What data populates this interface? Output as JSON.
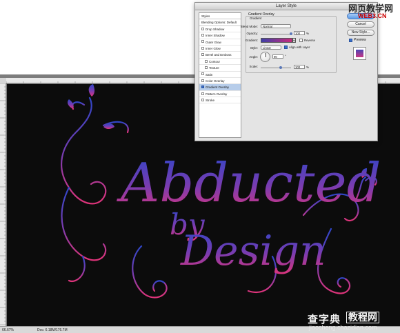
{
  "dialog": {
    "title": "Layer Style",
    "styles_list": [
      {
        "label": "Styles",
        "checkbox": false,
        "checked": false,
        "header": true
      },
      {
        "label": "Blending Options: Default",
        "checkbox": false,
        "checked": false,
        "header": true
      },
      {
        "label": "Drop Shadow",
        "checkbox": true,
        "checked": false
      },
      {
        "label": "Inner Shadow",
        "checkbox": true,
        "checked": false
      },
      {
        "label": "Outer Glow",
        "checkbox": true,
        "checked": false
      },
      {
        "label": "Inner Glow",
        "checkbox": true,
        "checked": false
      },
      {
        "label": "Bevel and Emboss",
        "checkbox": true,
        "checked": false
      },
      {
        "label": "Contour",
        "checkbox": true,
        "checked": false,
        "sub": true
      },
      {
        "label": "Texture",
        "checkbox": true,
        "checked": false,
        "sub": true
      },
      {
        "label": "Satin",
        "checkbox": true,
        "checked": false
      },
      {
        "label": "Color Overlay",
        "checkbox": true,
        "checked": false
      },
      {
        "label": "Gradient Overlay",
        "checkbox": true,
        "checked": true,
        "selected": true
      },
      {
        "label": "Pattern Overlay",
        "checkbox": true,
        "checked": false
      },
      {
        "label": "Stroke",
        "checkbox": true,
        "checked": false
      }
    ],
    "panel": {
      "section_title": "Gradient Overlay",
      "group_title": "Gradient",
      "blend_mode_label": "Blend Mode:",
      "blend_mode_value": "Normal",
      "opacity_label": "Opacity:",
      "opacity_value": "100",
      "opacity_level": 1.0,
      "percent": "%",
      "gradient_label": "Gradient:",
      "gradient_colors": [
        "#3f3fa8",
        "#c72a7c"
      ],
      "reverse_label": "Reverse",
      "reverse_checked": false,
      "style_label": "Style:",
      "style_value": "Linear",
      "align_label": "Align with Layer",
      "align_checked": true,
      "angle_label": "Angle:",
      "angle_value": "90",
      "degree": "°",
      "scale_label": "Scale:",
      "scale_value": "100",
      "scale_level": 0.67
    },
    "buttons": {
      "ok": "OK",
      "cancel": "Cancel",
      "new_style": "New Style...",
      "preview": "Preview"
    }
  },
  "canvas": {
    "artwork_words": [
      "Abducted",
      "by",
      "Design"
    ],
    "gradient_colors": [
      "#3b47c9",
      "#d4357a"
    ]
  },
  "statusbar": {
    "zoom": "66.67%",
    "doc": "Doc: 6.18M/176.7M"
  },
  "watermarks": {
    "top_line1": "网页教学网",
    "top_line2": "WEB3.CN",
    "bottom_line1a": "查字典",
    "bottom_line1b": "教程网",
    "bottom_line2": "jiaocheng.chazidian.com"
  },
  "icons": {
    "dial": "angle-dial-icon",
    "gradient_picker": "chevron-down-icon"
  }
}
